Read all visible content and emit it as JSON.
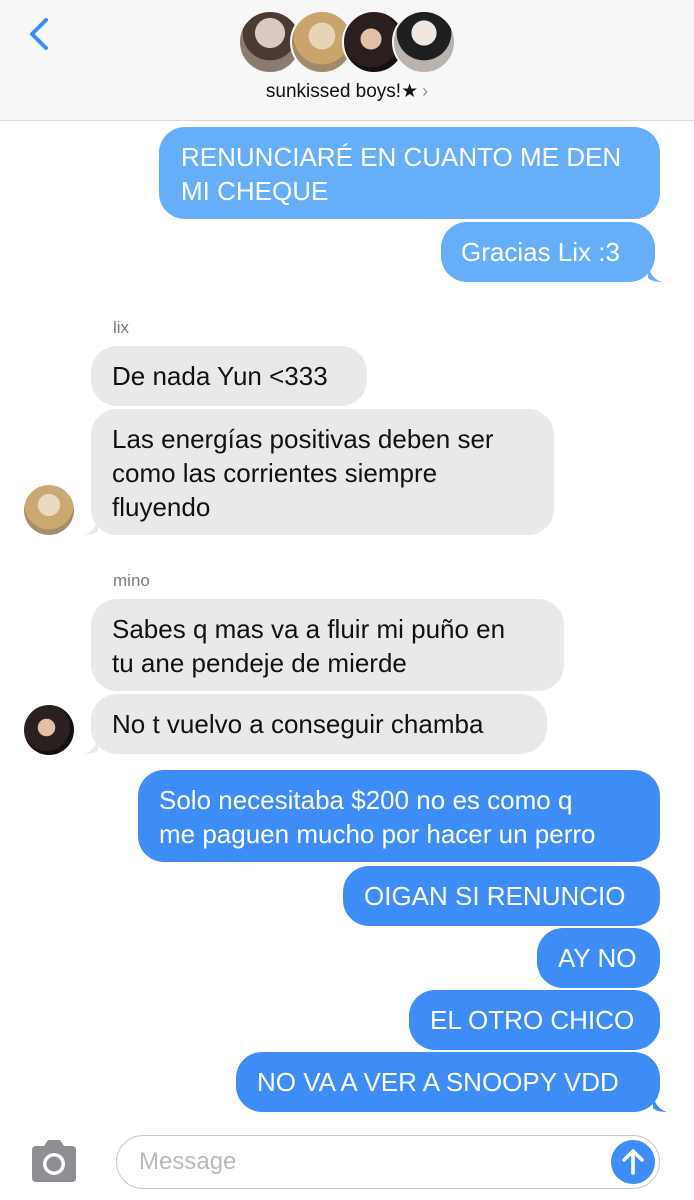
{
  "header": {
    "title": "sunkissed boys!★",
    "chevron": "›",
    "back_icon": "chevron-left-icon",
    "accent": "#3e8df7"
  },
  "messages": [
    {
      "dir": "out",
      "text": "RENUNCIARÉ EN CUANTO ME DEN\nMI CHEQUE"
    },
    {
      "dir": "out",
      "text": "Gracias Lix :3"
    },
    {
      "dir": "in",
      "sender": "lix",
      "text": "De nada Yun <333"
    },
    {
      "dir": "in",
      "sender": "lix",
      "text": "Las energías positivas deben ser\ncomo las corrientes siempre\nfluyendo"
    },
    {
      "dir": "in",
      "sender": "mino",
      "text": "Sabes q mas va a fluir mi puño en\ntu ane pendeje de mierde"
    },
    {
      "dir": "in",
      "sender": "mino",
      "text": "No t vuelvo a conseguir chamba"
    },
    {
      "dir": "out",
      "text": "Solo necesitaba $200 no es como q\nme paguen mucho por hacer un perro"
    },
    {
      "dir": "out",
      "text": "OIGAN SI RENUNCIO"
    },
    {
      "dir": "out",
      "text": "AY NO"
    },
    {
      "dir": "out",
      "text": "EL OTRO CHICO"
    },
    {
      "dir": "out",
      "text": "NO VA A VER A SNOOPY VDD"
    }
  ],
  "input": {
    "placeholder": "Message",
    "camera_icon": "camera-icon",
    "send_icon": "arrow-up-icon"
  }
}
